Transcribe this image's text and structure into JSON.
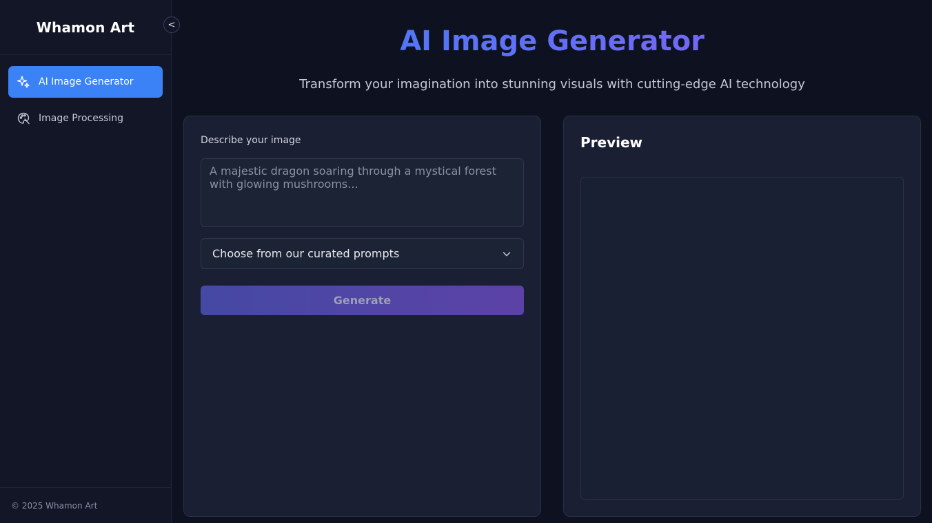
{
  "sidebar": {
    "brand": "Whamon Art",
    "collapse_label": "<",
    "items": [
      {
        "label": "AI Image Generator",
        "icon": "sparkles-icon",
        "active": true
      },
      {
        "label": "Image Processing",
        "icon": "palette-icon",
        "active": false
      }
    ],
    "footer": "© 2025 Whamon Art"
  },
  "header": {
    "title": "AI Image Generator",
    "subtitle": "Transform your imagination into stunning visuals with cutting-edge AI technology"
  },
  "form": {
    "prompt_label": "Describe your image",
    "prompt_value": "",
    "prompt_placeholder": "A majestic dragon soaring through a mystical forest with glowing mushrooms...",
    "curated_select": "Choose from our curated prompts",
    "generate_label": "Generate"
  },
  "preview": {
    "title": "Preview"
  },
  "colors": {
    "accent": "#3b82f6",
    "gradient_start": "#3b82f6",
    "gradient_end": "#8b5cf6",
    "background": "#0d1120",
    "card": "#1a1f33"
  }
}
